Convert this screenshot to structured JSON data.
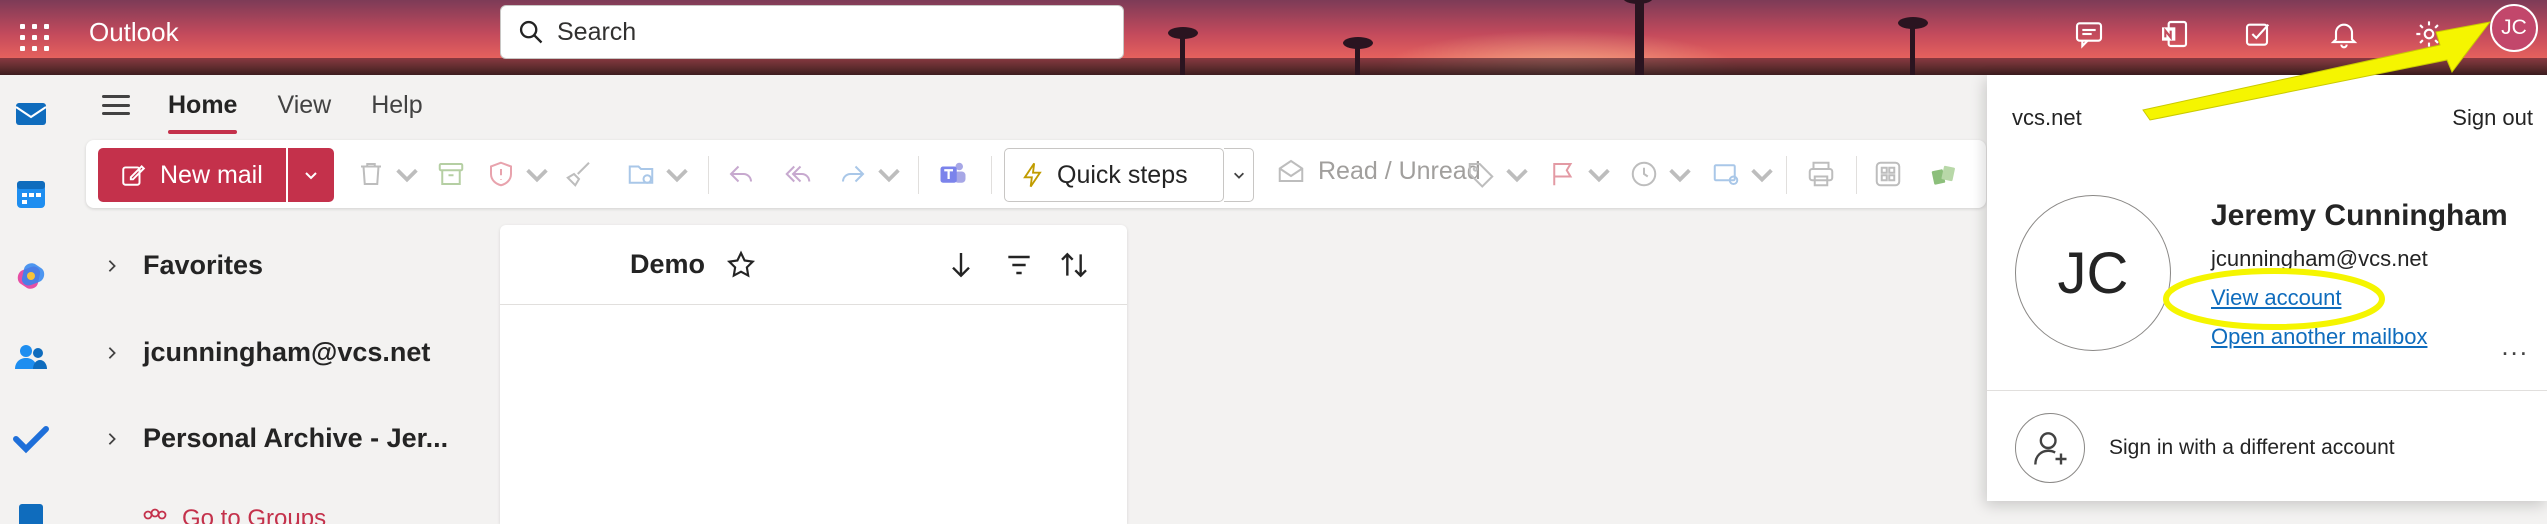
{
  "app": {
    "title": "Outlook"
  },
  "search": {
    "placeholder": "Search"
  },
  "header": {
    "avatar_initials": "JC",
    "icons": [
      "chat-icon",
      "onenote-icon",
      "tasks-icon",
      "bell-icon",
      "settings-icon"
    ]
  },
  "rail": {
    "icons": [
      "mail-app-icon",
      "calendar-app-icon",
      "copilot-app-icon",
      "people-app-icon",
      "todo-app-icon",
      "files-app-icon"
    ]
  },
  "ribbon": {
    "tabs": [
      "Home",
      "View",
      "Help"
    ],
    "new_mail": "New mail",
    "quick_steps": "Quick steps",
    "read_unread": "Read / Unread"
  },
  "folders": {
    "items": [
      "Favorites",
      "jcunningham@vcs.net",
      "Personal Archive - Jer..."
    ],
    "go_to_groups": "Go to Groups"
  },
  "message_list": {
    "title": "Demo"
  },
  "account_flyout": {
    "domain": "vcs.net",
    "sign_out": "Sign out",
    "initials": "JC",
    "name": "Jeremy Cunningham",
    "email": "jcunningham@vcs.net",
    "view_account": "View account",
    "open_another_mailbox": "Open another mailbox",
    "more": "...",
    "sign_in_different": "Sign in with a different account"
  },
  "colors": {
    "brand": "#c4314b",
    "link": "#0f6cbd",
    "highlight": "#f5f500"
  }
}
